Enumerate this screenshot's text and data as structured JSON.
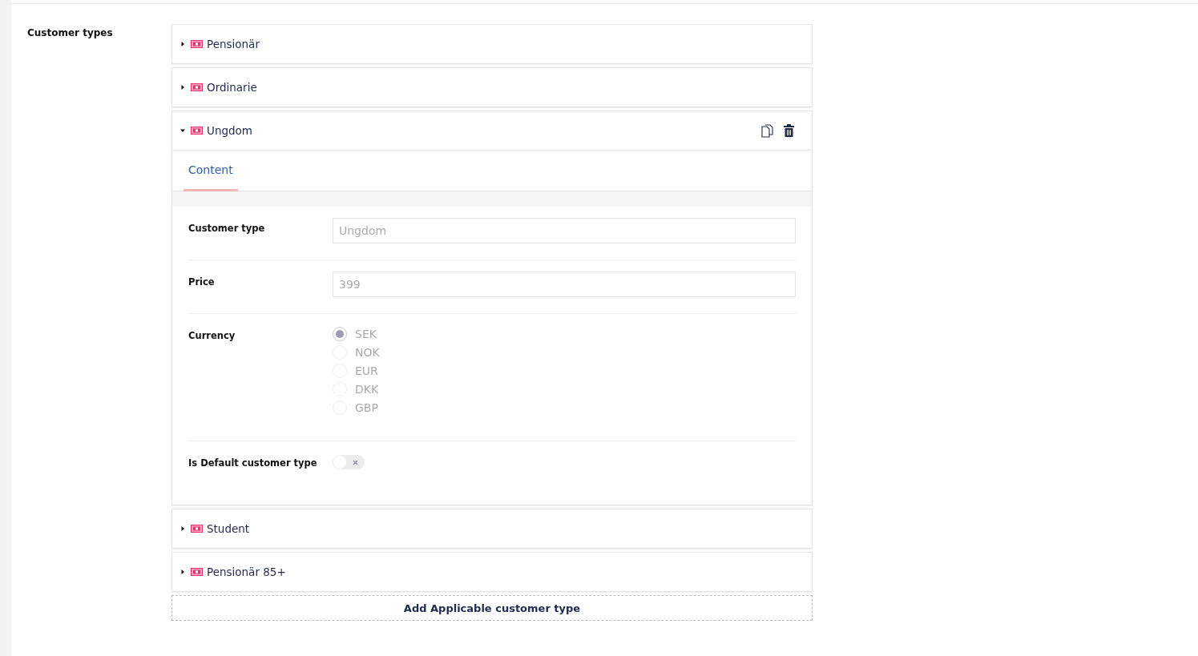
{
  "section_label": "Customer types",
  "items": [
    {
      "name": "Pensionär",
      "expanded": false
    },
    {
      "name": "Ordinarie",
      "expanded": false
    },
    {
      "name": "Ungdom",
      "expanded": true,
      "tabs": [
        {
          "label": "Content",
          "selected": true
        }
      ],
      "fields": [
        {
          "kind": "text",
          "label": "Customer type",
          "value": "Ungdom"
        },
        {
          "kind": "text",
          "label": "Price",
          "value": "399"
        },
        {
          "kind": "radio",
          "label": "Currency",
          "options": [
            {
              "label": "SEK",
              "selected": true
            },
            {
              "label": "NOK",
              "selected": false
            },
            {
              "label": "EUR",
              "selected": false
            },
            {
              "label": "DKK",
              "selected": false
            },
            {
              "label": "GBP",
              "selected": false
            }
          ]
        },
        {
          "kind": "toggle",
          "label": "Is Default customer type",
          "on": false
        }
      ]
    },
    {
      "name": "Student",
      "expanded": false
    },
    {
      "name": "Pensionär 85+",
      "expanded": false
    }
  ],
  "add_button": "Add Applicable customer type"
}
